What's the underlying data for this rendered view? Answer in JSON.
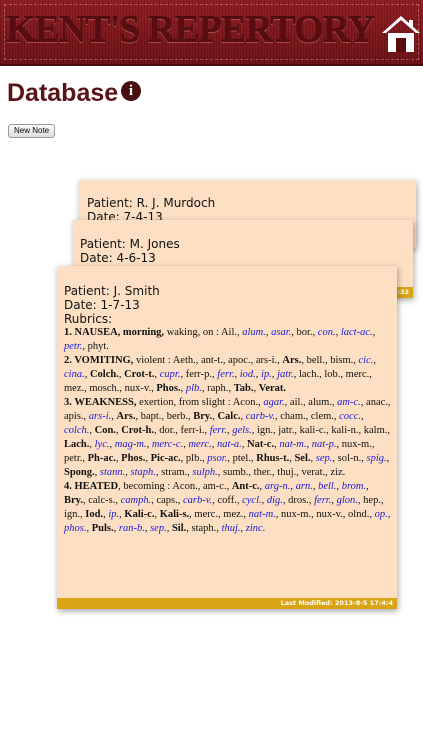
{
  "header": {
    "title": "KENT'S REPERTORY",
    "home_icon": "home-icon"
  },
  "page": {
    "title": "Database",
    "info_icon": "info-icon"
  },
  "toolbar": {
    "new_note_label": "New Note"
  },
  "notes": [
    {
      "patient": "Patient: R. J. Murdoch",
      "date": "Date: 7-4-13"
    },
    {
      "patient": "Patient: M. Jones",
      "date": "Date: 4-6-13",
      "footer_fragment": "2:32"
    },
    {
      "patient": "Patient: J. Smith",
      "date": "Date: 1-7-13",
      "rubrics_label": "Rubrics:",
      "footer": "Last Modified: 2013-8-5 17:4:4",
      "rubrics": [
        {
          "num": "1.",
          "title": "NAUSEA, morning,",
          "rest": " waking, on :",
          "remedies": [
            [
              "Ail.",
              1
            ],
            [
              "alum.",
              2
            ],
            [
              "asar.",
              2
            ],
            [
              "bor.",
              1
            ],
            [
              "con.",
              2
            ],
            [
              "lact-ac.",
              2
            ],
            [
              "petr.",
              2
            ],
            [
              "phyt.",
              1
            ]
          ]
        },
        {
          "num": "2.",
          "title": "VOMITING,",
          "rest": " violent :",
          "remedies": [
            [
              "Aeth.",
              1
            ],
            [
              "ant-t.",
              1
            ],
            [
              "apoc.",
              1
            ],
            [
              "ars-i.",
              1
            ],
            [
              "Ars.",
              3
            ],
            [
              "bell.",
              1
            ],
            [
              "bism.",
              1
            ],
            [
              "cic.",
              2
            ],
            [
              "cina.",
              2
            ],
            [
              "Colch.",
              3
            ],
            [
              "Crot-t.",
              3
            ],
            [
              "cupr.",
              2
            ],
            [
              "ferr-p.",
              1
            ],
            [
              "ferr.",
              2
            ],
            [
              "iod.",
              2
            ],
            [
              "ip.",
              2
            ],
            [
              "jatr.",
              2
            ],
            [
              "lach.",
              1
            ],
            [
              "lob.",
              1
            ],
            [
              "merc.",
              1
            ],
            [
              "mez.",
              1
            ],
            [
              "mosch.",
              1
            ],
            [
              "nux-v.",
              1
            ],
            [
              "Phos.",
              3
            ],
            [
              "plb.",
              2
            ],
            [
              "raph.",
              1
            ],
            [
              "Tab.",
              3
            ],
            [
              "Verat.",
              3
            ]
          ]
        },
        {
          "num": "3.",
          "title": "WEAKNESS,",
          "rest": " exertion, from slight :",
          "remedies": [
            [
              "Acon.",
              1
            ],
            [
              "agar.",
              2
            ],
            [
              "ail.",
              1
            ],
            [
              "alum.",
              1
            ],
            [
              "am-c.",
              2
            ],
            [
              "anac.",
              1
            ],
            [
              "apis.",
              1
            ],
            [
              "ars-i.",
              2
            ],
            [
              "Ars.",
              3
            ],
            [
              "bapt.",
              1
            ],
            [
              "berb.",
              1
            ],
            [
              "Bry.",
              3
            ],
            [
              "Calc.",
              3
            ],
            [
              "carb-v.",
              2
            ],
            [
              "cham.",
              1
            ],
            [
              "clem.",
              1
            ],
            [
              "cocc.",
              2
            ],
            [
              "colch.",
              2
            ],
            [
              "Con.",
              3
            ],
            [
              "Crot-h.",
              3
            ],
            [
              "dor.",
              1
            ],
            [
              "ferr-i.",
              1
            ],
            [
              "ferr.",
              2
            ],
            [
              "gels.",
              2
            ],
            [
              "ign.",
              1
            ],
            [
              "jatr.",
              1
            ],
            [
              "kali-c.",
              1
            ],
            [
              "kali-n.",
              1
            ],
            [
              "kalm.",
              1
            ],
            [
              "Lach.",
              3
            ],
            [
              "lyc.",
              2
            ],
            [
              "mag-m.",
              2
            ],
            [
              "merc-c.",
              2
            ],
            [
              "merc.",
              2
            ],
            [
              "nat-a.",
              2
            ],
            [
              "Nat-c.",
              3
            ],
            [
              "nat-m.",
              2
            ],
            [
              "nat-p.",
              2
            ],
            [
              "nux-m.",
              1
            ],
            [
              "petr.",
              1
            ],
            [
              "Ph-ac.",
              3
            ],
            [
              "Phos.",
              3
            ],
            [
              "Pic-ac.",
              3
            ],
            [
              "plb.",
              1
            ],
            [
              "psor.",
              2
            ],
            [
              "ptel.",
              1
            ],
            [
              "Rhus-t.",
              3
            ],
            [
              "Sel.",
              3
            ],
            [
              "sep.",
              2
            ],
            [
              "sol-n.",
              1
            ],
            [
              "spig.",
              2
            ],
            [
              "Spong.",
              3
            ],
            [
              "stann.",
              2
            ],
            [
              "staph.",
              2
            ],
            [
              "stram.",
              1
            ],
            [
              "sulph.",
              2
            ],
            [
              "sumb.",
              1
            ],
            [
              "ther.",
              1
            ],
            [
              "thuj.",
              1
            ],
            [
              "verat.",
              1
            ],
            [
              "ziz.",
              1
            ]
          ]
        },
        {
          "num": "4.",
          "title": "HEATED",
          "rest": ", becoming :",
          "remedies": [
            [
              "Acon.",
              1
            ],
            [
              "am-c.",
              1
            ],
            [
              "Ant-c.",
              3
            ],
            [
              "arg-n.",
              2
            ],
            [
              "arn.",
              2
            ],
            [
              "bell.",
              2
            ],
            [
              "brom.",
              2
            ],
            [
              "Bry.",
              3
            ],
            [
              "calc-s.",
              1
            ],
            [
              "camph.",
              2
            ],
            [
              "caps.",
              1
            ],
            [
              "carb-v.",
              2
            ],
            [
              "coff.",
              1
            ],
            [
              "cycl.",
              2
            ],
            [
              "dig.",
              2
            ],
            [
              "dros.",
              1
            ],
            [
              "ferr.",
              2
            ],
            [
              "glon.",
              2
            ],
            [
              "hep.",
              1
            ],
            [
              "ign.",
              1
            ],
            [
              "Iod.",
              3
            ],
            [
              "ip.",
              2
            ],
            [
              "Kali-c.",
              3
            ],
            [
              "Kali-s.",
              3
            ],
            [
              "merc.",
              1
            ],
            [
              "mez.",
              1
            ],
            [
              "nat-m.",
              2
            ],
            [
              "nux-m.",
              1
            ],
            [
              "nux-v.",
              1
            ],
            [
              "olnd.",
              1
            ],
            [
              "op.",
              2
            ],
            [
              "phos.",
              2
            ],
            [
              "Puls.",
              3
            ],
            [
              "ran-b.",
              2
            ],
            [
              "sep.",
              2
            ],
            [
              "Sil.",
              3
            ],
            [
              "staph.",
              1
            ],
            [
              "thuj.",
              2
            ],
            [
              "zinc.",
              2
            ]
          ]
        }
      ]
    }
  ],
  "colors": {
    "banner": "#7a1418",
    "title": "#5a1418",
    "note_bg": "#fde0c4",
    "note_footer": "#d9a416",
    "remedy_link": "#1a1ad8"
  }
}
